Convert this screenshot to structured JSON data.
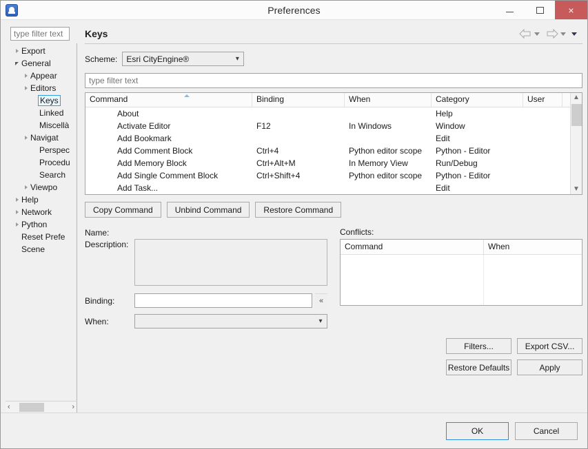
{
  "window": {
    "title": "Preferences",
    "app_icon": "cityengine-icon",
    "minimize_label": "Minimize",
    "maximize_label": "Maximize",
    "close_label": "×"
  },
  "sidebar": {
    "filter_placeholder": "type filter text",
    "items": [
      {
        "label": "Export",
        "indent": 1,
        "twisty": "collapsed",
        "selected": false
      },
      {
        "label": "General",
        "indent": 1,
        "twisty": "expanded",
        "selected": false
      },
      {
        "label": "Appear",
        "indent": 2,
        "twisty": "collapsed",
        "selected": false
      },
      {
        "label": "Editors",
        "indent": 2,
        "twisty": "collapsed",
        "selected": false
      },
      {
        "label": "Keys",
        "indent": 3,
        "twisty": "none",
        "selected": true
      },
      {
        "label": "Linked",
        "indent": 3,
        "twisty": "none",
        "selected": false
      },
      {
        "label": "Miscellà",
        "indent": 3,
        "twisty": "none",
        "selected": false
      },
      {
        "label": "Navigat",
        "indent": 2,
        "twisty": "collapsed",
        "selected": false
      },
      {
        "label": "Perspec",
        "indent": 3,
        "twisty": "none",
        "selected": false
      },
      {
        "label": "Procedu",
        "indent": 3,
        "twisty": "none",
        "selected": false
      },
      {
        "label": "Search",
        "indent": 3,
        "twisty": "none",
        "selected": false
      },
      {
        "label": "Viewpo",
        "indent": 2,
        "twisty": "collapsed",
        "selected": false
      },
      {
        "label": "Help",
        "indent": 1,
        "twisty": "collapsed",
        "selected": false
      },
      {
        "label": "Network",
        "indent": 1,
        "twisty": "collapsed",
        "selected": false
      },
      {
        "label": "Python",
        "indent": 1,
        "twisty": "collapsed",
        "selected": false
      },
      {
        "label": "Reset Prefe",
        "indent": 1,
        "twisty": "none",
        "selected": false
      },
      {
        "label": "Scene",
        "indent": 1,
        "twisty": "none",
        "selected": false
      }
    ],
    "hscroll": {
      "left": "‹",
      "right": "›"
    }
  },
  "page": {
    "title": "Keys",
    "nav_back": "back-arrow",
    "nav_forward": "forward-arrow",
    "scheme_label": "Scheme:",
    "scheme_value": "Esri CityEngine®",
    "filter_placeholder": "type filter text"
  },
  "table": {
    "columns": [
      "Command",
      "Binding",
      "When",
      "Category",
      "User"
    ],
    "sorted_column": "Command",
    "rows": [
      {
        "command": "About",
        "binding": "",
        "when": "",
        "category": "Help",
        "user": ""
      },
      {
        "command": "Activate Editor",
        "binding": "F12",
        "when": "In Windows",
        "category": "Window",
        "user": ""
      },
      {
        "command": "Add Bookmark",
        "binding": "",
        "when": "",
        "category": "Edit",
        "user": ""
      },
      {
        "command": "Add Comment Block",
        "binding": "Ctrl+4",
        "when": "Python editor scope",
        "category": "Python - Editor",
        "user": ""
      },
      {
        "command": "Add Memory Block",
        "binding": "Ctrl+Alt+M",
        "when": "In Memory View",
        "category": "Run/Debug",
        "user": ""
      },
      {
        "command": "Add Single Comment Block",
        "binding": "Ctrl+Shift+4",
        "when": "Python editor scope",
        "category": "Python - Editor",
        "user": ""
      },
      {
        "command": "Add Task...",
        "binding": "",
        "when": "",
        "category": "Edit",
        "user": ""
      }
    ]
  },
  "command_buttons": {
    "copy": "Copy Command",
    "unbind": "Unbind Command",
    "restore": "Restore Command"
  },
  "detail": {
    "name_label": "Name:",
    "name_value": "",
    "description_label": "Description:",
    "description_value": "",
    "binding_label": "Binding:",
    "binding_value": "",
    "binding_chevron": "«",
    "when_label": "When:",
    "when_value": ""
  },
  "conflicts": {
    "label": "Conflicts:",
    "columns": [
      "Command",
      "When"
    ],
    "rows": []
  },
  "lower_buttons": {
    "filters": "Filters...",
    "export_csv": "Export CSV...",
    "restore_defaults": "Restore Defaults",
    "apply": "Apply"
  },
  "footer": {
    "ok": "OK",
    "cancel": "Cancel"
  },
  "colors": {
    "accent": "#2e8ddf",
    "close_button": "#c75b5b",
    "selection_border": "#2e9fd8",
    "chrome": "#f0f0f0"
  }
}
